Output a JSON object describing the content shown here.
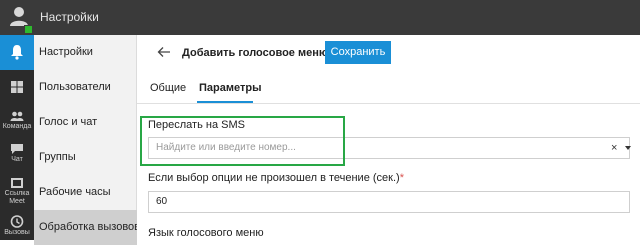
{
  "topbar": {
    "title": "Настройки"
  },
  "rail": {
    "items": [
      {
        "icon": "bell-icon",
        "label": ""
      },
      {
        "icon": "windows-icon",
        "label": ""
      },
      {
        "icon": "team-icon",
        "label": "Команда"
      },
      {
        "icon": "chat-icon",
        "label": "Чат"
      },
      {
        "icon": "meet-icon",
        "label": "Ссылка Meet"
      },
      {
        "icon": "calls-icon",
        "label": "Вызовы"
      }
    ]
  },
  "menu": {
    "items": [
      {
        "label": "Настройки"
      },
      {
        "label": "Пользователи"
      },
      {
        "label": "Голос и чат"
      },
      {
        "label": "Группы"
      },
      {
        "label": "Рабочие часы"
      },
      {
        "label": "Обработка вызовов"
      }
    ]
  },
  "header": {
    "title": "Добавить голосовое меню",
    "save_label": "Сохранить"
  },
  "tabs": [
    {
      "label": "Общие"
    },
    {
      "label": "Параметры"
    }
  ],
  "form": {
    "forward_sms": {
      "label": "Переслать на SMS",
      "placeholder": "Найдите или введите номер...",
      "clear": "×"
    },
    "timeout": {
      "label": "Если выбор опции не произошел в течение (сек.)",
      "required_mark": "*",
      "value": "60"
    },
    "language": {
      "label": "Язык голосового меню"
    }
  },
  "colors": {
    "accent": "#1a8fd6",
    "highlight": "#28a745",
    "topbar": "#3a3a3a",
    "rail": "#2b2b2b"
  }
}
